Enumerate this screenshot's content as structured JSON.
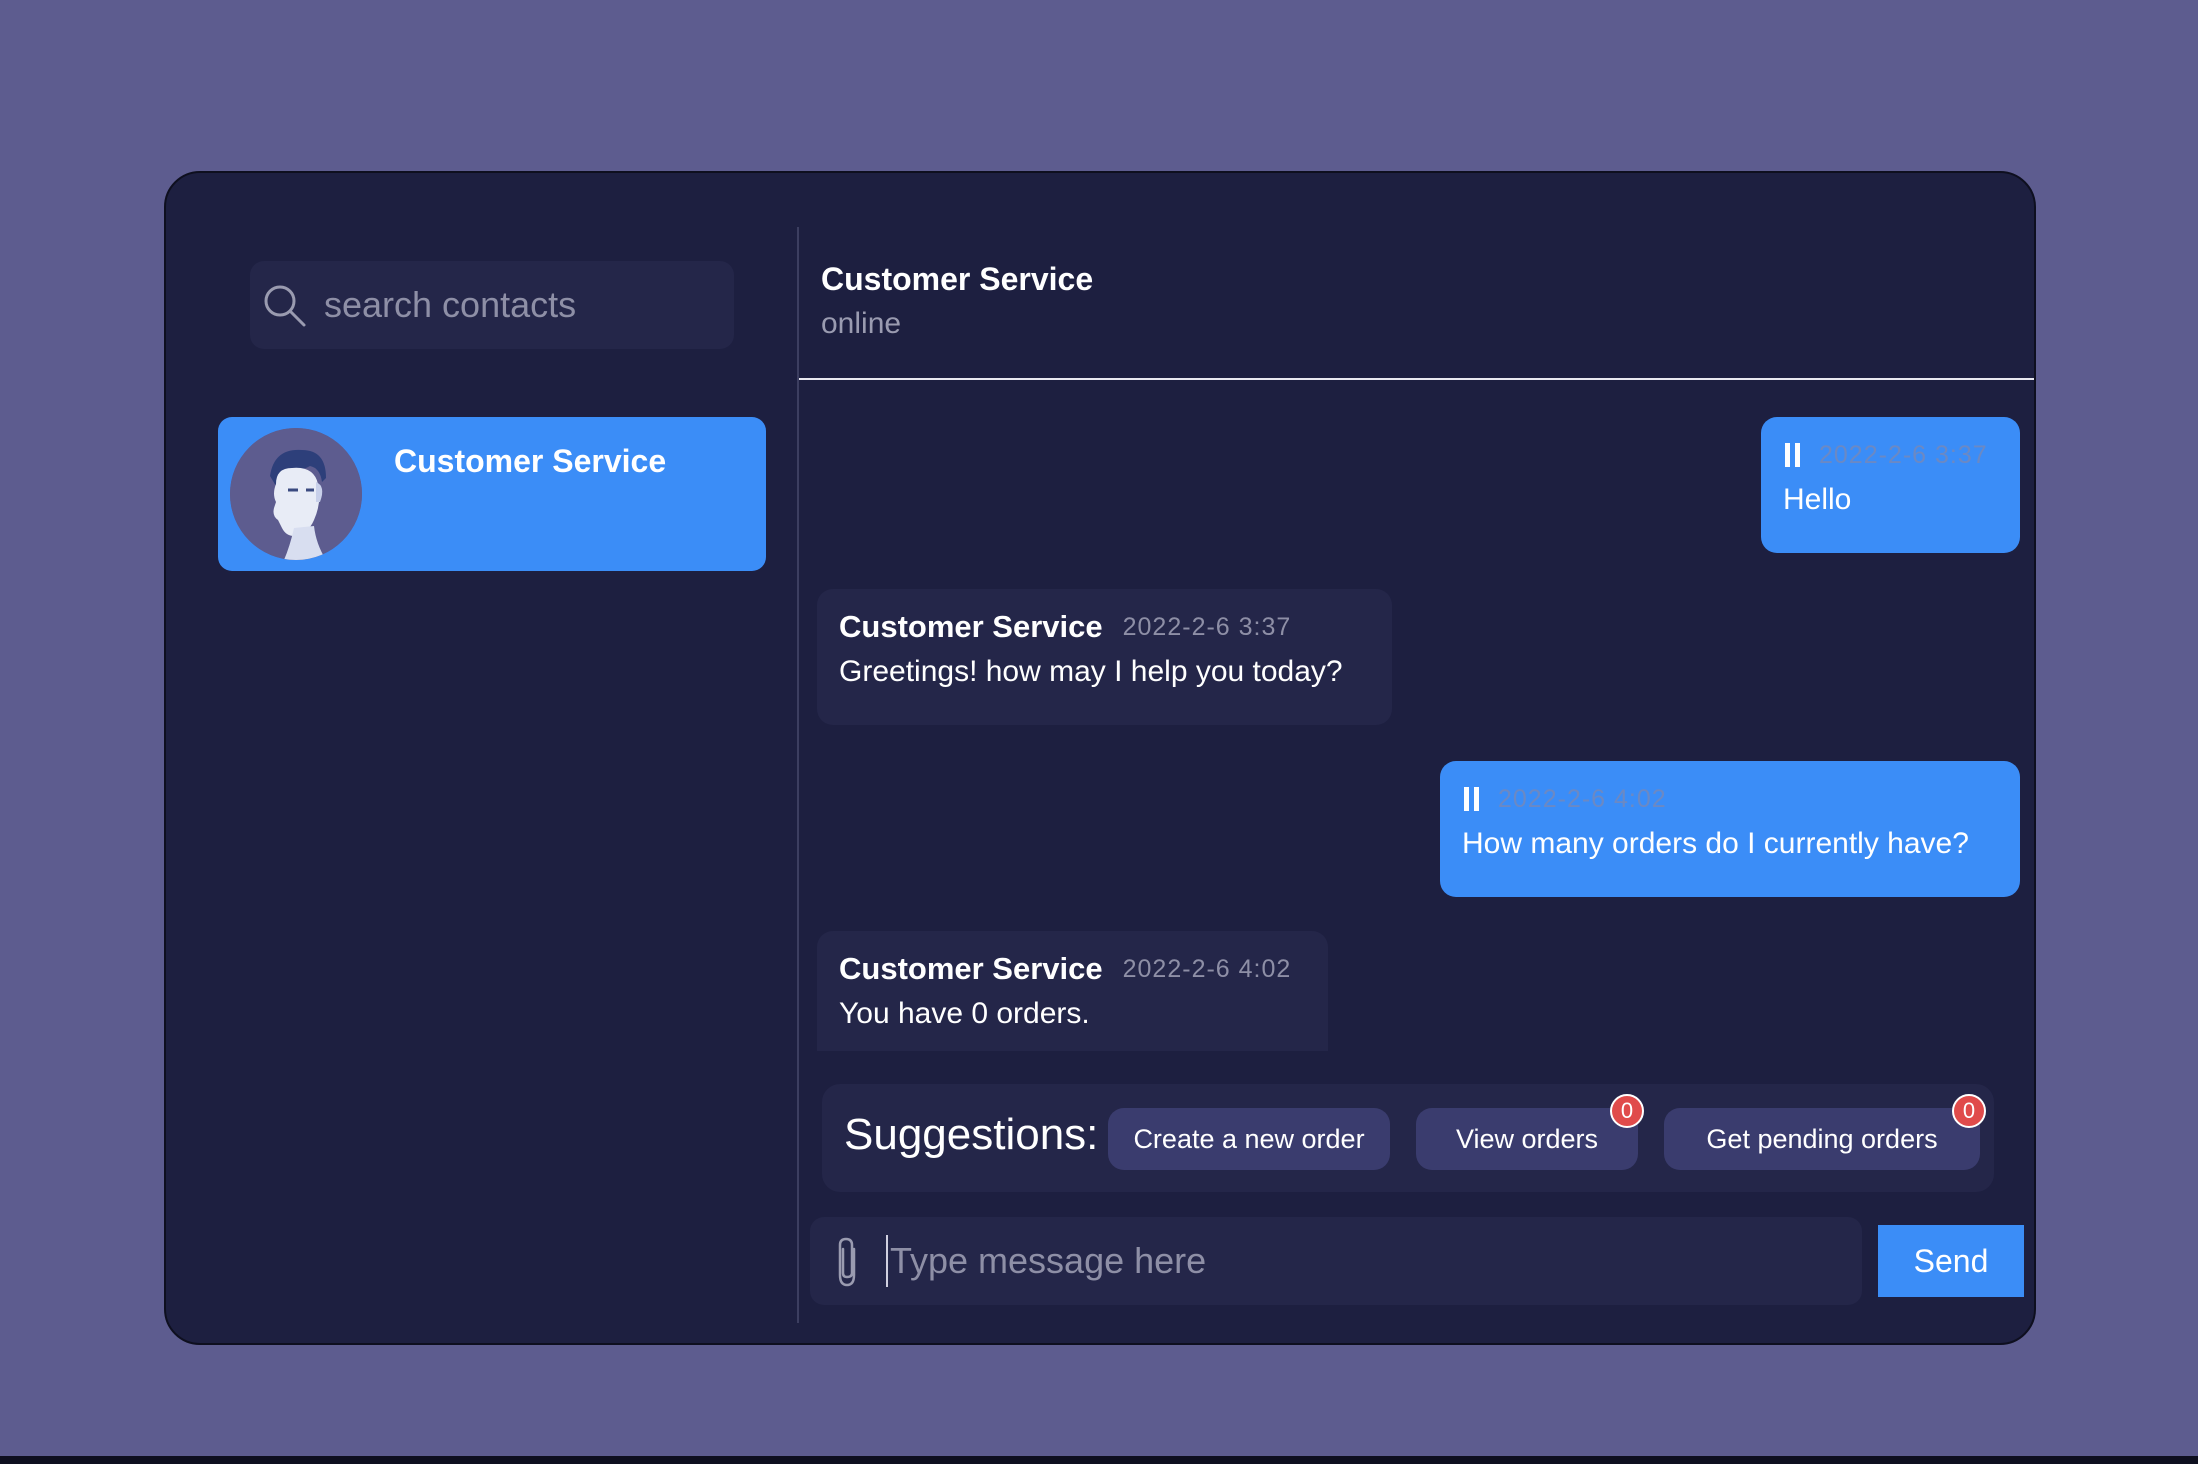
{
  "search": {
    "placeholder": "search contacts",
    "icon": "search-icon"
  },
  "contacts": [
    {
      "name": "Customer Service",
      "selected": true
    }
  ],
  "chat": {
    "title": "Customer Service",
    "status": "online",
    "messages": [
      {
        "direction": "out",
        "time": "2022-2-6 3:37",
        "text": "Hello"
      },
      {
        "direction": "in",
        "sender": "Customer Service",
        "time": "2022-2-6 3:37",
        "text": "Greetings! how may I help you today?"
      },
      {
        "direction": "out",
        "time": "2022-2-6 4:02",
        "text": "How many orders do I currently have?"
      },
      {
        "direction": "in",
        "sender": "Customer Service",
        "time": "2022-2-6 4:02",
        "text": "You have 0 orders."
      }
    ]
  },
  "suggestions": {
    "label": "Suggestions:",
    "items": [
      {
        "label": "Create a new order"
      },
      {
        "label": "View orders",
        "badge": "0"
      },
      {
        "label": "Get pending orders",
        "badge": "0"
      }
    ]
  },
  "composer": {
    "placeholder": "Type message here",
    "send_label": "Send"
  },
  "colors": {
    "accent": "#3b8df7",
    "panel": "#1d1f40",
    "background": "#5d5c8f",
    "badge": "#e04b4b"
  }
}
